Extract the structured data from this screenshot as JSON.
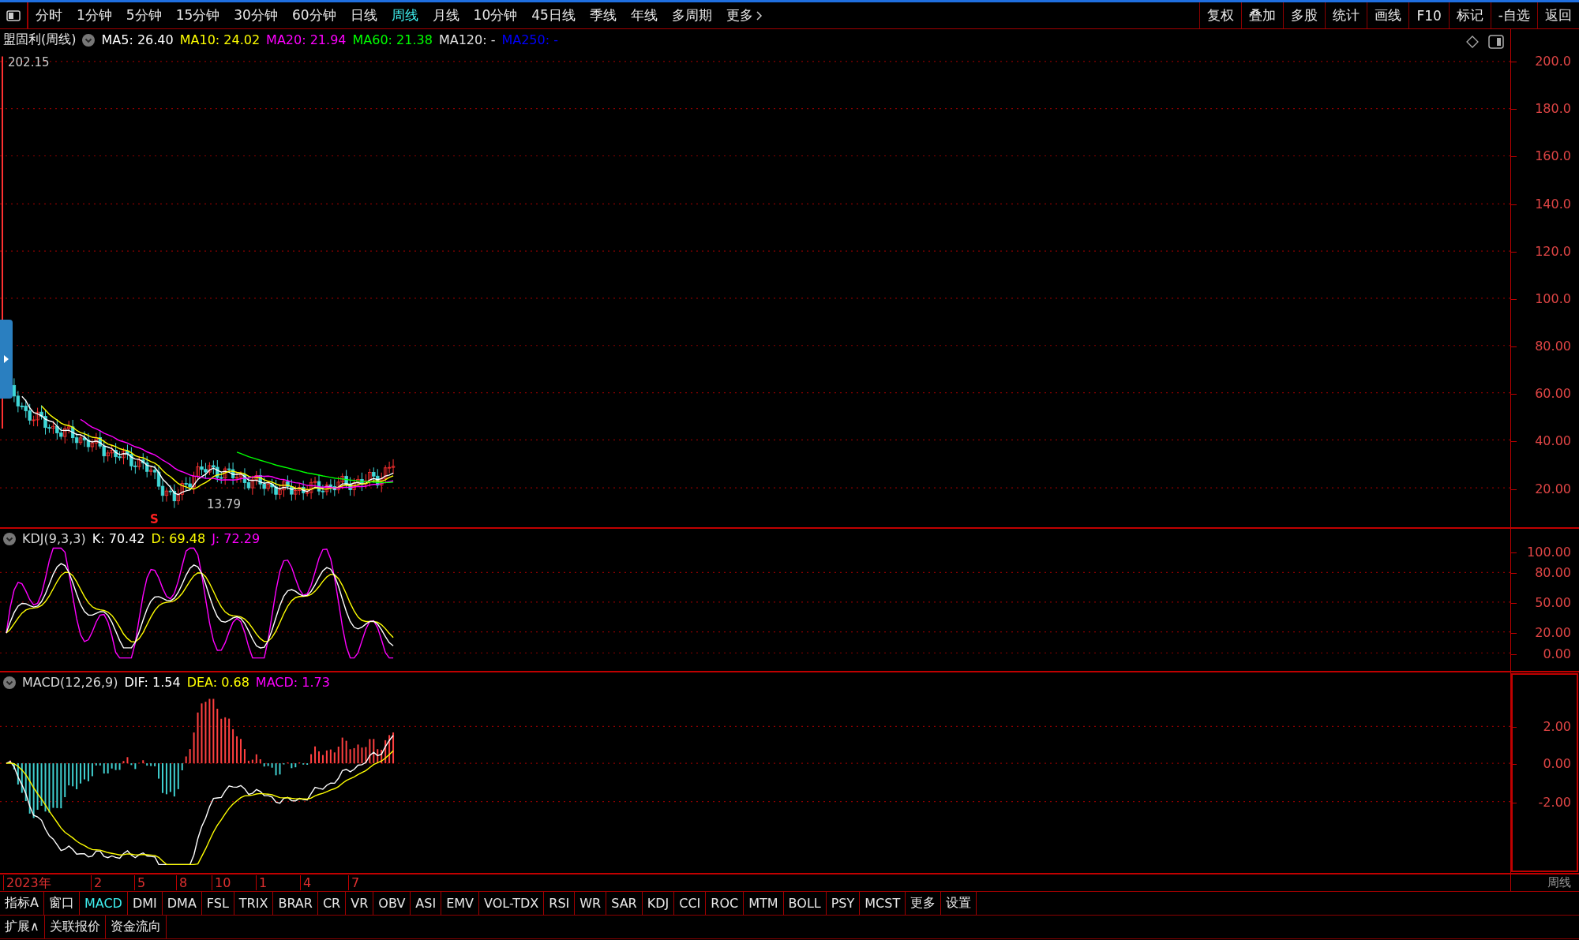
{
  "toolbar": {
    "periods": [
      {
        "label": "分时",
        "selected": false
      },
      {
        "label": "1分钟",
        "selected": false
      },
      {
        "label": "5分钟",
        "selected": false
      },
      {
        "label": "15分钟",
        "selected": false
      },
      {
        "label": "30分钟",
        "selected": false
      },
      {
        "label": "60分钟",
        "selected": false
      },
      {
        "label": "日线",
        "selected": false
      },
      {
        "label": "周线",
        "selected": true
      },
      {
        "label": "月线",
        "selected": false
      },
      {
        "label": "10分钟",
        "selected": false
      },
      {
        "label": "45日线",
        "selected": false
      },
      {
        "label": "季线",
        "selected": false
      },
      {
        "label": "年线",
        "selected": false
      },
      {
        "label": "多周期",
        "selected": false
      }
    ],
    "more": "更多",
    "actions": [
      "复权",
      "叠加",
      "多股",
      "统计",
      "画线",
      "F10",
      "标记",
      "-自选",
      "返回"
    ]
  },
  "price_panel": {
    "title": "盟固利(周线)",
    "indicators": [
      {
        "label": "MA5: 26.40",
        "color": "#ffffff"
      },
      {
        "label": "MA10: 24.02",
        "color": "#ffff00"
      },
      {
        "label": "MA20: 21.94",
        "color": "#ff00ff"
      },
      {
        "label": "MA60: 21.38",
        "color": "#00ff00"
      },
      {
        "label": "MA120: -",
        "color": "#e0e0e0"
      },
      {
        "label": "MA250: -",
        "color": "#0000ff"
      }
    ],
    "high_label": "202.15",
    "low_label": "13.79",
    "signal_marker": "S",
    "y_axis": [
      "200.0",
      "180.0",
      "160.0",
      "140.0",
      "120.0",
      "100.0",
      "80.00",
      "60.00",
      "40.00",
      "20.00"
    ]
  },
  "kdj_panel": {
    "title": "KDJ(9,3,3)",
    "indicators": [
      {
        "label": "K: 70.42",
        "color": "#ffffff"
      },
      {
        "label": "D: 69.48",
        "color": "#ffff00"
      },
      {
        "label": "J: 72.29",
        "color": "#ff00ff"
      }
    ],
    "y_axis": [
      "100.00",
      "80.00",
      "50.00",
      "20.00",
      "0.00"
    ]
  },
  "macd_panel": {
    "title": "MACD(12,26,9)",
    "indicators": [
      {
        "label": "DIF: 1.54",
        "color": "#ffffff"
      },
      {
        "label": "DEA: 0.68",
        "color": "#ffff00"
      },
      {
        "label": "MACD: 1.73",
        "color": "#ff00ff"
      }
    ],
    "y_axis": [
      "2.00",
      "0.00",
      "-2.00"
    ]
  },
  "time_axis": {
    "labels": [
      "2023年",
      "2",
      "5",
      "8",
      "10",
      "1",
      "4",
      "7"
    ],
    "period": "周线"
  },
  "indicator_tabs": [
    {
      "label": "指标A",
      "selected": false
    },
    {
      "label": "窗口",
      "selected": false
    },
    {
      "label": "MACD",
      "selected": true
    },
    {
      "label": "DMI",
      "selected": false
    },
    {
      "label": "DMA",
      "selected": false
    },
    {
      "label": "FSL",
      "selected": false
    },
    {
      "label": "TRIX",
      "selected": false
    },
    {
      "label": "BRAR",
      "selected": false
    },
    {
      "label": "CR",
      "selected": false
    },
    {
      "label": "VR",
      "selected": false
    },
    {
      "label": "OBV",
      "selected": false
    },
    {
      "label": "ASI",
      "selected": false
    },
    {
      "label": "EMV",
      "selected": false
    },
    {
      "label": "VOL-TDX",
      "selected": false
    },
    {
      "label": "RSI",
      "selected": false
    },
    {
      "label": "WR",
      "selected": false
    },
    {
      "label": "SAR",
      "selected": false
    },
    {
      "label": "KDJ",
      "selected": false
    },
    {
      "label": "CCI",
      "selected": false
    },
    {
      "label": "ROC",
      "selected": false
    },
    {
      "label": "MTM",
      "selected": false
    },
    {
      "label": "BOLL",
      "selected": false
    },
    {
      "label": "PSY",
      "selected": false
    },
    {
      "label": "MCST",
      "selected": false
    },
    {
      "label": "更多",
      "selected": false
    },
    {
      "label": "设置",
      "selected": false
    }
  ],
  "bottom_tabs": [
    "扩展∧",
    "关联报价",
    "资金流向"
  ]
}
